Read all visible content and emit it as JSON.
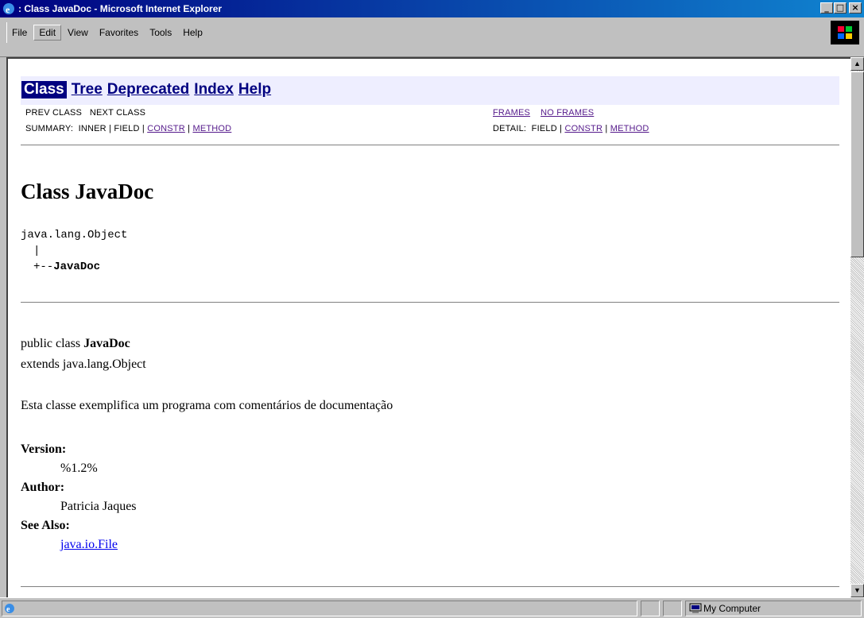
{
  "window": {
    "title": ": Class JavaDoc - Microsoft Internet Explorer",
    "buttons": {
      "minimize": "_",
      "maximize": "□",
      "close": "×"
    }
  },
  "menu": {
    "items": [
      {
        "label": "File"
      },
      {
        "label": "Edit"
      },
      {
        "label": "View"
      },
      {
        "label": "Favorites"
      },
      {
        "label": "Tools"
      },
      {
        "label": "Help"
      }
    ]
  },
  "nav": {
    "items": [
      {
        "label": "Class"
      },
      {
        "label": "Tree"
      },
      {
        "label": "Deprecated"
      },
      {
        "label": "Index"
      },
      {
        "label": "Help"
      }
    ],
    "prev_class": "PREV CLASS",
    "next_class": "NEXT CLASS",
    "frames": "FRAMES",
    "no_frames": "NO FRAMES",
    "summary_label": "SUMMARY:",
    "summary_inner": "INNER",
    "summary_field": "FIELD",
    "summary_constr": "CONSTR",
    "summary_method": "METHOD",
    "detail_label": "DETAIL:",
    "detail_field": "FIELD",
    "detail_constr": "CONSTR",
    "detail_method": "METHOD",
    "separator": "|"
  },
  "doc": {
    "heading": "Class JavaDoc",
    "tree_root": "java.lang.Object",
    "tree_pipe": "|",
    "tree_branch": "+--",
    "tree_child": "JavaDoc",
    "decl_prefix": "public class ",
    "decl_name": "JavaDoc",
    "extends": "extends java.lang.Object",
    "description": "Esta classe exemplifica um programa com comentários de documentação",
    "version_label": "Version:",
    "version_value": "%1.2%",
    "author_label": "Author:",
    "author_value": "Patricia Jaques",
    "see_also_label": "See Also:",
    "see_also_link": "java.io.File"
  },
  "status": {
    "zone": "My Computer"
  }
}
